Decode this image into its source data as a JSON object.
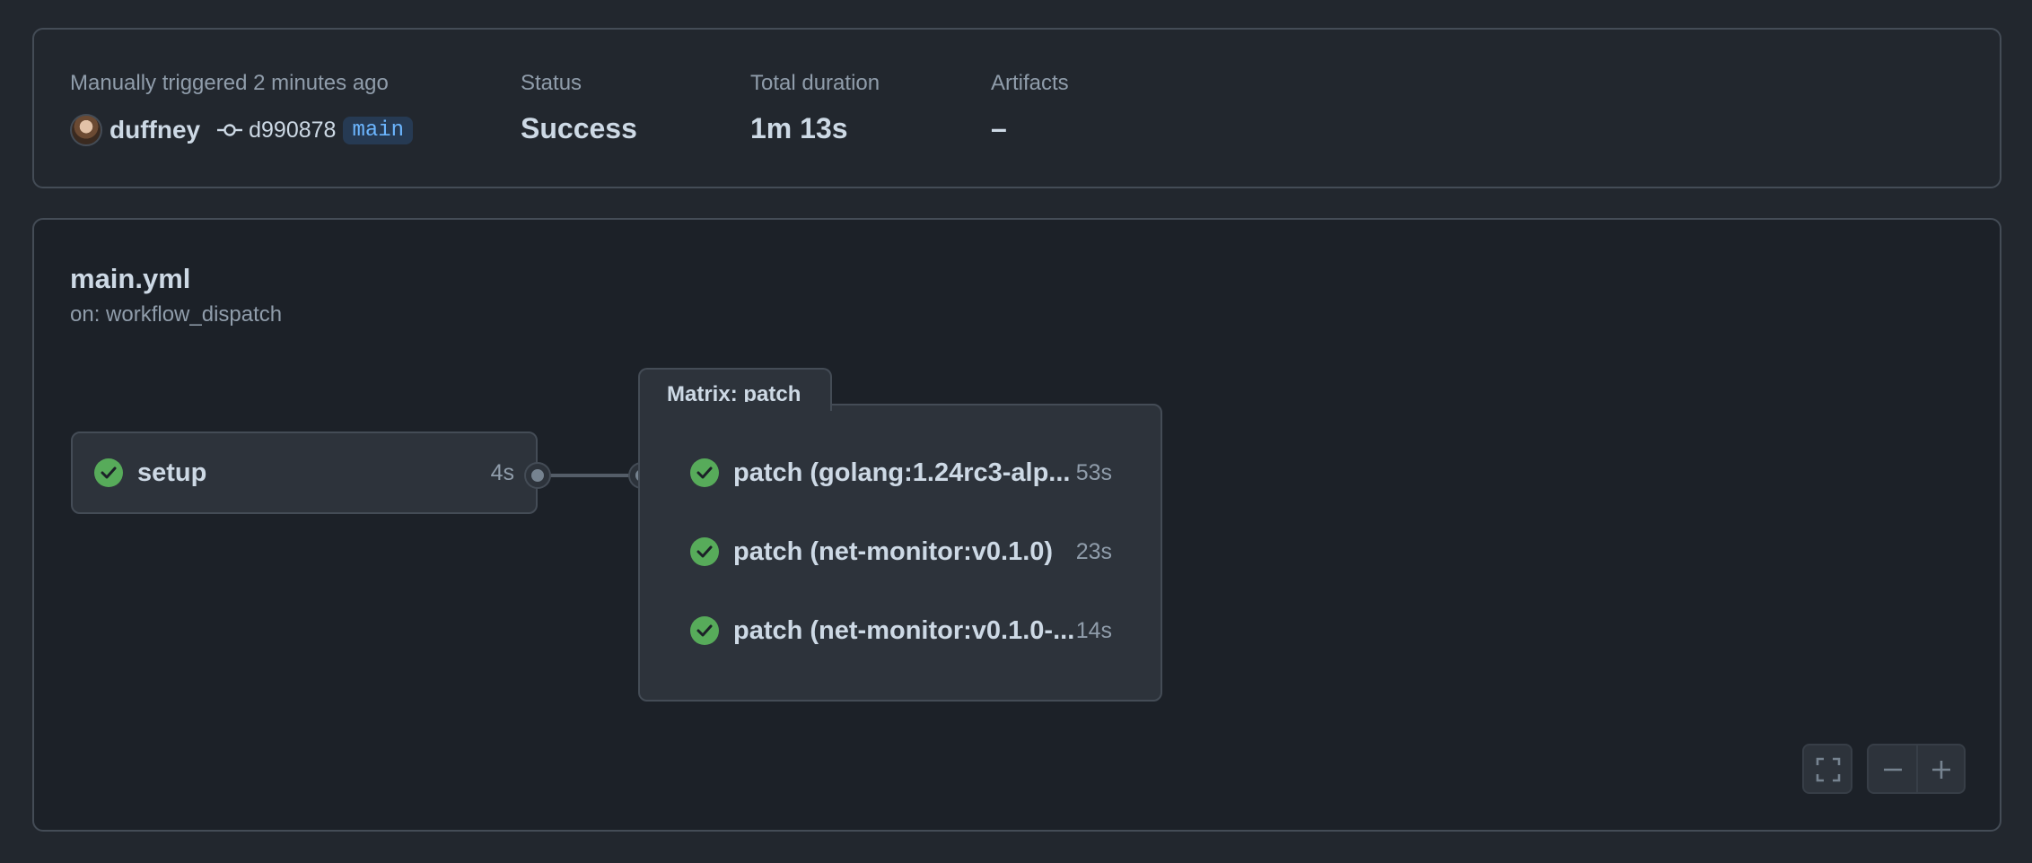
{
  "summary": {
    "trigger_label": "Manually triggered 2 minutes ago",
    "actor": "duffney",
    "commit_sha": "d990878",
    "branch": "main",
    "status_label": "Status",
    "status_value": "Success",
    "duration_label": "Total duration",
    "duration_value": "1m 13s",
    "artifacts_label": "Artifacts",
    "artifacts_value": "–"
  },
  "workflow": {
    "file": "main.yml",
    "trigger": "on: workflow_dispatch"
  },
  "jobs": {
    "setup": {
      "name": "setup",
      "duration": "4s",
      "status": "success"
    },
    "matrix": {
      "label": "Matrix: patch",
      "items": [
        {
          "name": "patch (golang:1.24rc3-alp...",
          "duration": "53s",
          "status": "success"
        },
        {
          "name": "patch (net-monitor:v0.1.0)",
          "duration": "23s",
          "status": "success"
        },
        {
          "name": "patch (net-monitor:v0.1.0-...",
          "duration": "14s",
          "status": "success"
        }
      ]
    }
  },
  "colors": {
    "success": "#57ab5a",
    "branch_bg": "#263a53",
    "branch_fg": "#6cb6ff"
  },
  "icons": [
    "avatar",
    "git-commit-icon",
    "check-circle-icon",
    "fullscreen-icon",
    "zoom-out-icon",
    "zoom-in-icon"
  ]
}
